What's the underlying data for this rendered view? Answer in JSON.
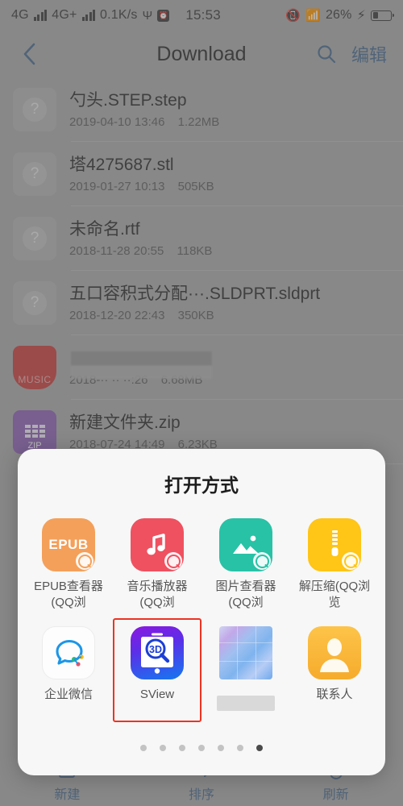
{
  "statusbar": {
    "network_1": "4G",
    "network_2": "4G+",
    "data_rate": "0.1K/s",
    "usb_icon": "usb-icon",
    "alarm_icon": "alarm-icon",
    "clock": "15:53",
    "vibrate_icon": "vibrate-icon",
    "wifi_icon": "wifi-icon",
    "battery_percent": "26%",
    "charging_icon": "charging-bolt-icon"
  },
  "titlebar": {
    "back_icon": "chevron-left-icon",
    "title": "Download",
    "search_icon": "search-icon",
    "edit_label": "编辑"
  },
  "files": [
    {
      "icon": "unknown-file-icon",
      "name": "勺头.STEP.step",
      "date": "2019-04-10 13:46",
      "size": "1.22MB",
      "censored": false
    },
    {
      "icon": "unknown-file-icon",
      "name": "塔4275687.stl",
      "date": "2019-01-27 10:13",
      "size": "505KB",
      "censored": false
    },
    {
      "icon": "unknown-file-icon",
      "name": "未命名.rtf",
      "date": "2018-11-28 20:55",
      "size": "118KB",
      "censored": false
    },
    {
      "icon": "unknown-file-icon",
      "name": "五口容积式分配···.SLDPRT.sldprt",
      "date": "2018-12-20 22:43",
      "size": "350KB",
      "censored": false
    },
    {
      "icon": "music-file-icon",
      "icon_label": "MUSIC",
      "name": "",
      "date": "2018-·· ·· ··:26",
      "size": "6.68MB",
      "censored": true
    },
    {
      "icon": "zip-file-icon",
      "icon_label": "ZIP",
      "name": "新建文件夹.zip",
      "date": "2018-07-24 14:49",
      "size": "6.23KB",
      "censored": false
    }
  ],
  "bottombar": {
    "items": [
      {
        "icon": "new-folder-icon",
        "label": "新建"
      },
      {
        "icon": "sort-icon",
        "label": "排序"
      },
      {
        "icon": "refresh-icon",
        "label": "刷新"
      }
    ]
  },
  "dialog": {
    "title": "打开方式",
    "apps": [
      {
        "icon": "epub-app-icon",
        "icon_text": "EPUB",
        "label": "EPUB查看器(QQ浏",
        "selected": false,
        "censored": false
      },
      {
        "icon": "music-note-app-icon",
        "icon_text": "",
        "label": "音乐播放器(QQ浏",
        "selected": false,
        "censored": false
      },
      {
        "icon": "image-viewer-app-icon",
        "icon_text": "",
        "label": "图片查看器(QQ浏",
        "selected": false,
        "censored": false
      },
      {
        "icon": "unzip-app-icon",
        "icon_text": "",
        "label": "解压缩(QQ浏览",
        "selected": false,
        "censored": false
      },
      {
        "icon": "wecom-app-icon",
        "icon_text": "",
        "label": "企业微信",
        "selected": false,
        "censored": false
      },
      {
        "icon": "sview-3d-app-icon",
        "icon_text": "3D",
        "label": "SView",
        "selected": true,
        "censored": false
      },
      {
        "icon": "mosaic-app-icon",
        "icon_text": "",
        "label": "",
        "selected": false,
        "censored": true
      },
      {
        "icon": "contacts-app-icon",
        "icon_text": "",
        "label": "联系人",
        "selected": false,
        "censored": false
      }
    ],
    "pager": {
      "total": 7,
      "active_index": 6
    }
  },
  "colors": {
    "accent_blue": "#4a6b90",
    "selection_red": "#ee3322",
    "dialog_bg": "#f7f7f7",
    "backdrop": "#a9aaa9"
  }
}
